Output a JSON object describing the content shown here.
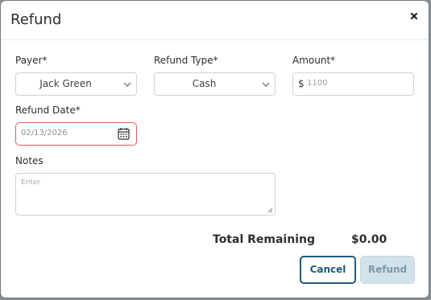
{
  "modal": {
    "title": "Refund"
  },
  "form": {
    "payer_label": "Payer*",
    "payer_value": "Jack Green",
    "refund_type_label": "Refund Type*",
    "refund_type_value": "Cash",
    "amount_label": "Amount*",
    "amount_currency": "$",
    "amount_value": "1100",
    "refund_date_label": "Refund Date*",
    "refund_date_value": "02/13/2026",
    "notes_label": "Notes",
    "notes_placeholder": "Enter"
  },
  "summary": {
    "total_remaining_label": "Total Remaining",
    "total_remaining_value": "$0.00"
  },
  "actions": {
    "cancel_label": "Cancel",
    "refund_label": "Refund"
  },
  "colors": {
    "primary": "#1e5a78",
    "error_border": "#e25b5b",
    "disabled_button_bg": "#d1e2ea"
  },
  "icons": {
    "close": "close-icon",
    "dropdown": "chevron-down-icon",
    "calendar": "calendar-icon",
    "resize": "resize-handle-icon"
  }
}
